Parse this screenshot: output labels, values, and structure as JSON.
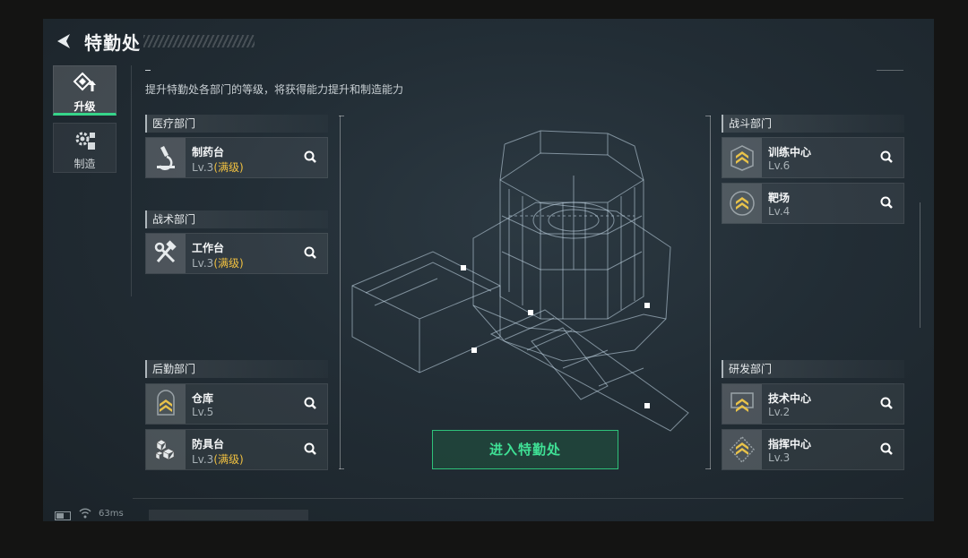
{
  "header": {
    "title": "特勤处",
    "back_icon": "back-arrow-icon"
  },
  "nav": [
    {
      "label": "升级",
      "icon": "upgrade-icon",
      "active": true
    },
    {
      "label": "制造",
      "icon": "gears-icon",
      "active": false
    }
  ],
  "description": "提升特勤处各部门的等级，将获得能力提升和制造能力",
  "departments": {
    "medical": {
      "title": "医疗部门",
      "facilities": [
        {
          "name": "制药台",
          "level": "Lv.3",
          "status": "(满级)",
          "icon": "microscope-icon"
        }
      ]
    },
    "tactical": {
      "title": "战术部门",
      "facilities": [
        {
          "name": "工作台",
          "level": "Lv.3",
          "status": "(满级)",
          "icon": "hammer-wrench-icon"
        }
      ]
    },
    "logistics": {
      "title": "后勤部门",
      "facilities": [
        {
          "name": "仓库",
          "level": "Lv.5",
          "status": "",
          "icon": "chevron-rank-icon"
        },
        {
          "name": "防具台",
          "level": "Lv.3",
          "status": "(满级)",
          "icon": "cubes-icon"
        }
      ]
    },
    "combat": {
      "title": "战斗部门",
      "facilities": [
        {
          "name": "训练中心",
          "level": "Lv.6",
          "status": "",
          "icon": "chevron-rank-icon"
        },
        {
          "name": "靶场",
          "level": "Lv.4",
          "status": "",
          "icon": "chevron-rank-icon"
        }
      ]
    },
    "research": {
      "title": "研发部门",
      "facilities": [
        {
          "name": "技术中心",
          "level": "Lv.2",
          "status": "",
          "icon": "chevron-rank-icon"
        },
        {
          "name": "指挥中心",
          "level": "Lv.3",
          "status": "",
          "icon": "chevron-rank-icon"
        }
      ]
    }
  },
  "enter_button": "进入特勤处",
  "status_bar": {
    "ping": "63ms"
  },
  "colors": {
    "accent_green": "#36d58a",
    "maxed_gold": "#f0c040",
    "rank_gold": "#e8c24a"
  }
}
